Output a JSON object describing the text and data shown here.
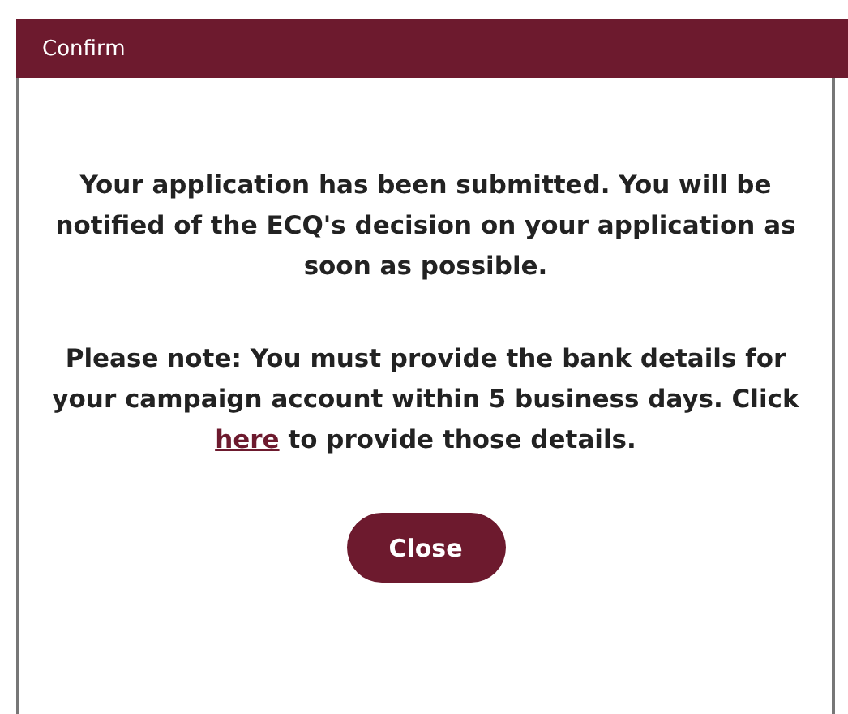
{
  "window": {
    "title": "Confirm"
  },
  "message": "Your application has been submitted. You will be notified of the ECQ's decision on your application as soon as possible.",
  "note": {
    "before": "Please note: You must provide the bank details for your campaign account within 5 business days. Click ",
    "link": "here",
    "after": " to provide those details."
  },
  "buttons": [
    "Close"
  ]
}
